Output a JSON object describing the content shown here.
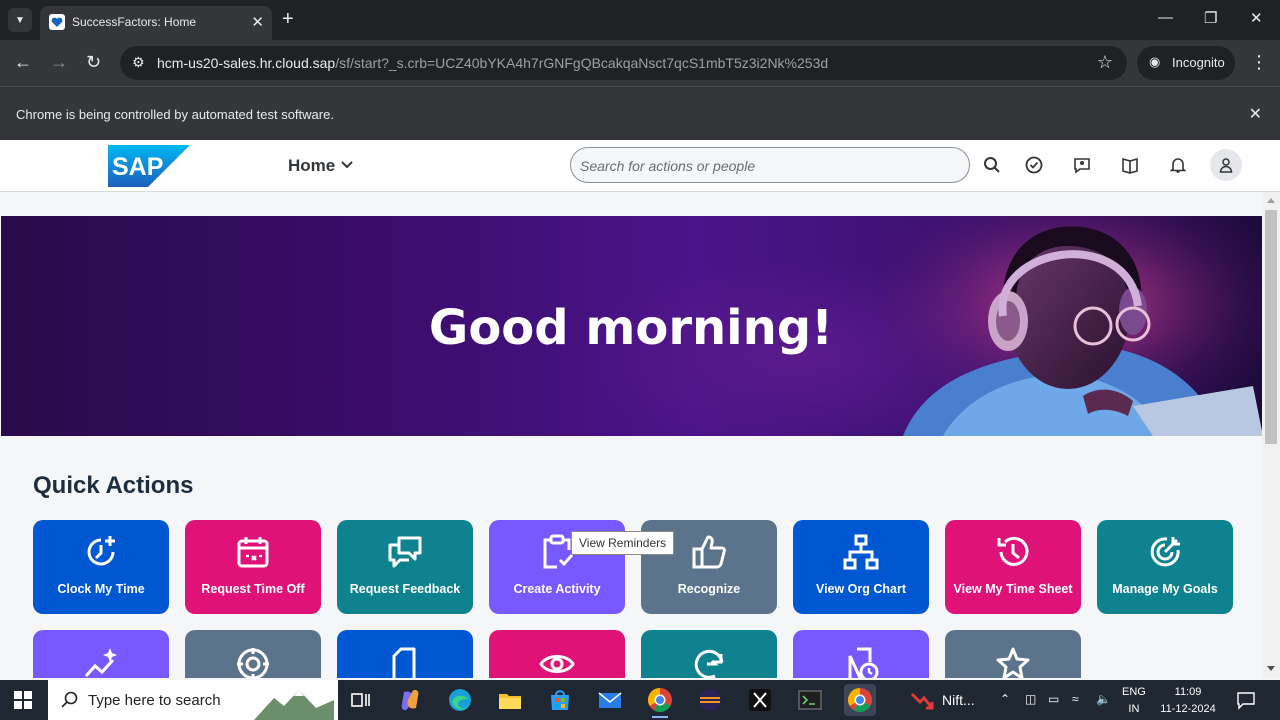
{
  "browser": {
    "tab_title": "SuccessFactors: Home",
    "new_tab": "+",
    "url_host": "hcm-us20-sales.hr.cloud.sap",
    "url_path": "/sf/start?_s.crb=UCZ40bYKA4h7rGNFgQBcakqaNsct7qcS1mbT5z3i2Nk%253d",
    "incognito_label": "Incognito",
    "infobar_text": "Chrome is being controlled by automated test software."
  },
  "header": {
    "logo_text": "SAP",
    "home_label": "Home",
    "search_placeholder": "Search for actions or people"
  },
  "hero": {
    "greeting": "Good morning!"
  },
  "quick_actions": {
    "title": "Quick Actions",
    "tiles": [
      {
        "label": "Clock My Time",
        "color": "#0057d2"
      },
      {
        "label": "Request Time Off",
        "color": "#df1278"
      },
      {
        "label": "Request Feedback",
        "color": "#0f828f"
      },
      {
        "label": "Create Activity",
        "color": "#7858ff"
      },
      {
        "label": "Recognize",
        "color": "#5b738b"
      },
      {
        "label": "View Org Chart",
        "color": "#0057d2"
      },
      {
        "label": "View My Time Sheet",
        "color": "#df1278"
      },
      {
        "label": "Manage My Goals",
        "color": "#0f828f"
      }
    ],
    "tooltip": "View Reminders"
  },
  "taskbar": {
    "search_placeholder": "Type here to search",
    "nifty_label": "Nift...",
    "lang_top": "ENG",
    "lang_bottom": "IN",
    "time": "11:09",
    "date": "11-12-2024"
  }
}
